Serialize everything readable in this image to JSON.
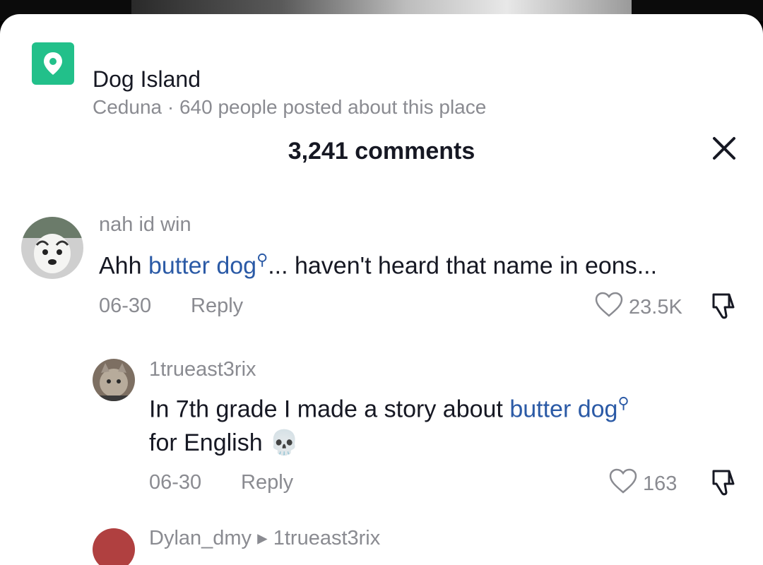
{
  "location": {
    "title": "Dog Island",
    "subtitle": "Ceduna · 640 people posted about this place",
    "icon": "map-pin-icon",
    "icon_color": "#22c08a"
  },
  "comments_header": {
    "title": "3,241 comments",
    "close_icon": "close-icon"
  },
  "comments": [
    {
      "username": "nah id win",
      "text_before": "Ahh ",
      "link": "butter dog",
      "text_after": "... haven't heard that name in eons...",
      "date": "06-30",
      "reply_label": "Reply",
      "likes": "23.5K"
    },
    {
      "username": "1trueast3rix",
      "text_before": "In 7th grade I made a story about ",
      "link": "butter dog",
      "text_after": "for English 💀",
      "date": "06-30",
      "reply_label": "Reply",
      "likes": "163"
    },
    {
      "username": "Dylan_dmy ▸ 1trueast3rix"
    }
  ],
  "colors": {
    "link": "#2b5aa6",
    "muted": "#8a8b91",
    "text": "#161823"
  }
}
